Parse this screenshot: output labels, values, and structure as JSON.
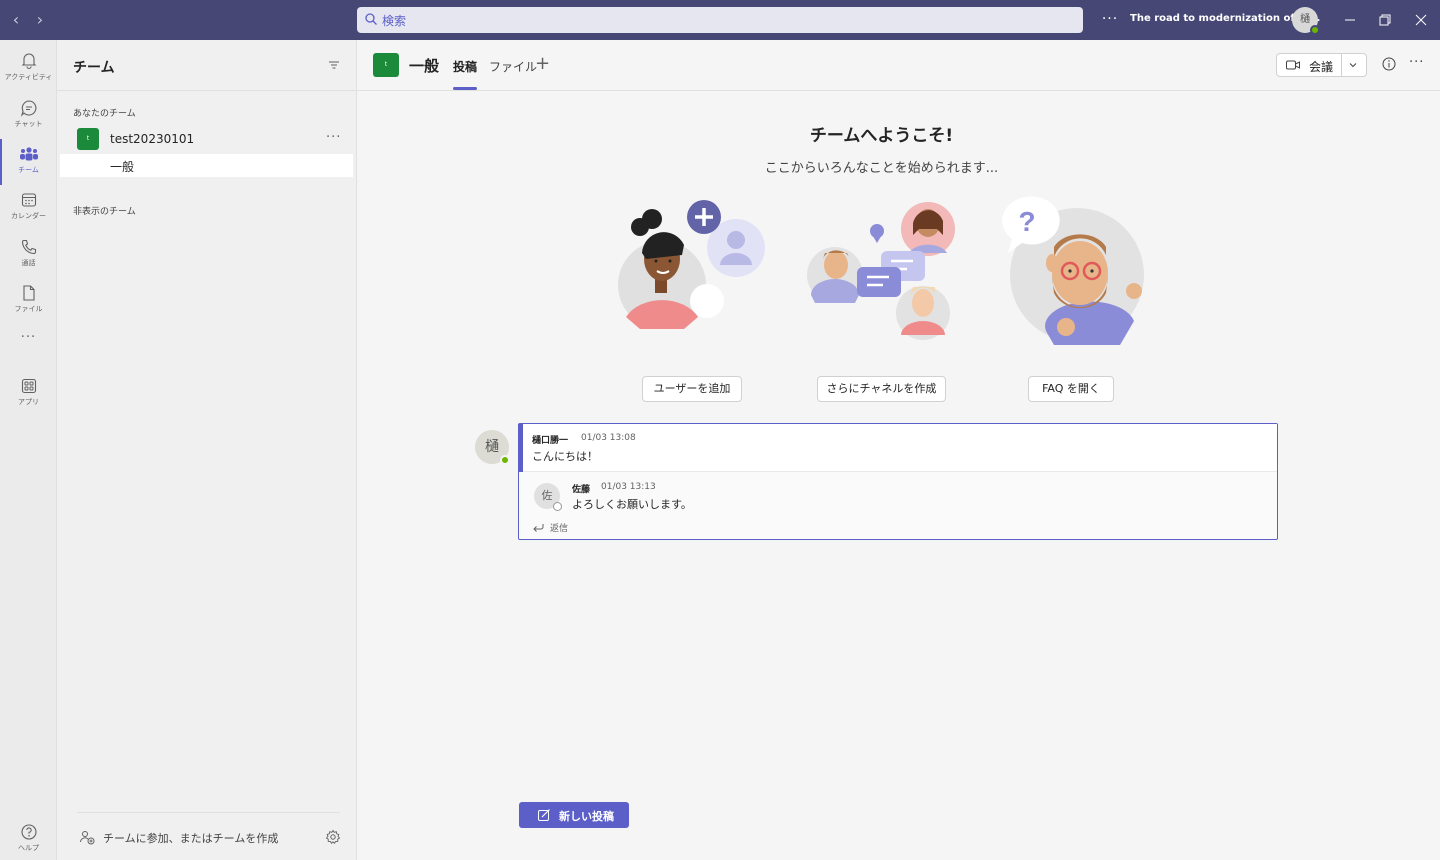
{
  "titlebar": {
    "search_placeholder": "検索",
    "more": "···",
    "window_title": "The road to modernization of of...",
    "avatar_initial": "樋"
  },
  "rail": {
    "items": [
      {
        "label": "アクティビティ",
        "icon": "bell-icon"
      },
      {
        "label": "チャット",
        "icon": "chat-icon"
      },
      {
        "label": "チーム",
        "icon": "teams-icon"
      },
      {
        "label": "カレンダー",
        "icon": "calendar-icon"
      },
      {
        "label": "通話",
        "icon": "phone-icon"
      },
      {
        "label": "ファイル",
        "icon": "file-icon"
      },
      {
        "label": "···",
        "icon": "more-icon"
      },
      {
        "label": "アプリ",
        "icon": "apps-icon"
      },
      {
        "label": "ヘルプ",
        "icon": "help-icon"
      }
    ],
    "active": "チーム"
  },
  "panel": {
    "title": "チーム",
    "your_teams_label": "あなたのチーム",
    "team": {
      "avatar": "t",
      "name": "test20230101",
      "more": "···"
    },
    "channel": "一般",
    "hidden_label": "非表示のチーム",
    "join_text": "チームに参加、またはチームを作成"
  },
  "header": {
    "avatar": "t",
    "title": "一般",
    "tabs": [
      {
        "label": "投稿",
        "active": true
      },
      {
        "label": "ファイル",
        "active": false
      }
    ],
    "add": "+",
    "meet_label": "会議",
    "more": "···"
  },
  "welcome": {
    "title": "チームへようこそ!",
    "subtitle": "ここからいろんなことを始められます...",
    "cards": [
      {
        "button": "ユーザーを追加"
      },
      {
        "button": "さらにチャネルを作成"
      },
      {
        "button": "FAQ を開く"
      }
    ]
  },
  "thread": {
    "post": {
      "avatar": "樋",
      "author": "樋口勝一",
      "time": "01/03 13:08",
      "text": "こんにちは！"
    },
    "reply": {
      "avatar": "佐",
      "author": "佐藤",
      "time": "01/03 13:13",
      "text": "よろしくお願いします。"
    },
    "reply_label": "返信"
  },
  "compose": {
    "new_post_label": "新しい投稿"
  },
  "colors": {
    "brand": "#5b5fc7",
    "titlebar": "#464775",
    "team_green": "#1b8a3b",
    "presence": "#6bb700"
  }
}
